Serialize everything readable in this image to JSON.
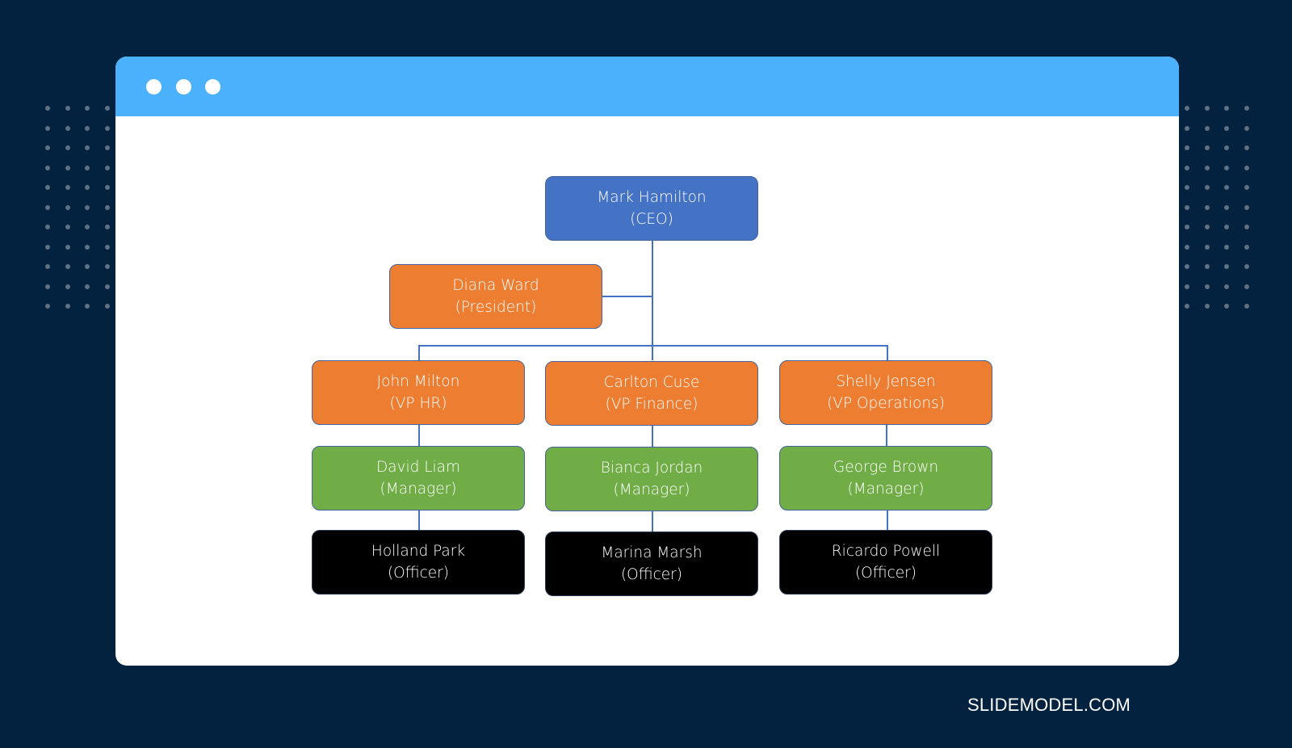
{
  "window": {
    "titlebar_color": "#4bb1fc",
    "controls": [
      "dot-1",
      "dot-2",
      "dot-3"
    ]
  },
  "org_chart": {
    "ceo": {
      "name": "Mark Hamilton",
      "role": "(CEO)",
      "color": "#4472c4"
    },
    "president": {
      "name": "Diana Ward",
      "role": "(President)",
      "color": "#ed7d31"
    },
    "vps": [
      {
        "name": "John Milton",
        "role": "(VP HR)"
      },
      {
        "name": "Carlton Cuse",
        "role": "(VP Finance)"
      },
      {
        "name": "Shelly Jensen",
        "role": "(VP Operations)"
      }
    ],
    "managers": [
      {
        "name": "David Liam",
        "role": "(Manager)"
      },
      {
        "name": "Bianca Jordan",
        "role": "(Manager)"
      },
      {
        "name": "George Brown",
        "role": "(Manager)"
      }
    ],
    "officers": [
      {
        "name": "Holland Park",
        "role": "(Officer)"
      },
      {
        "name": "Marina Marsh",
        "role": "(Officer)"
      },
      {
        "name": "Ricardo Powell",
        "role": "(Officer)"
      }
    ],
    "colors": {
      "vp": "#ed7d31",
      "manager": "#70ad47",
      "officer": "#000000",
      "connector": "#4472c4"
    }
  },
  "footer": {
    "brand": "SLIDEMODEL.COM"
  }
}
